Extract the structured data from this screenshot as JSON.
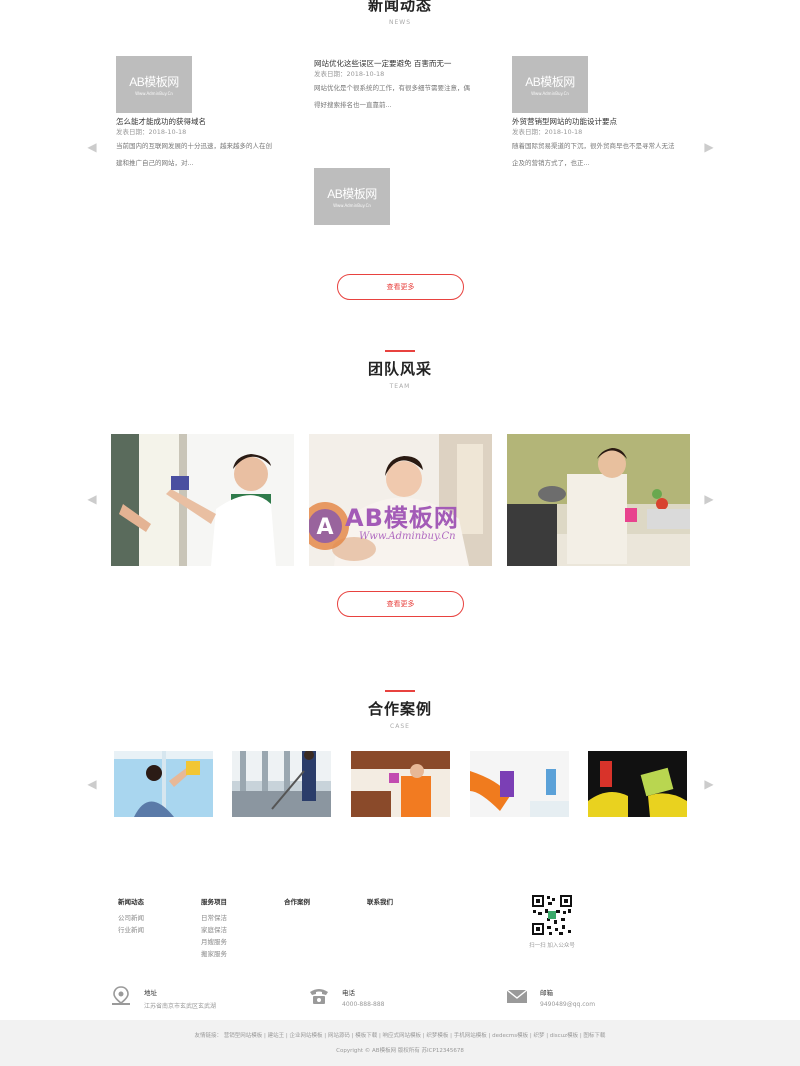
{
  "news": {
    "title": "新闻动态",
    "subtitle": "NEWS",
    "placeholder_logo": "AB模板网",
    "placeholder_sub": "Www.AdminBuy.Cn",
    "date_label": "发表日期：",
    "items": [
      {
        "title": "怎么能才能成功的获得域名",
        "date": "2018-10-18",
        "desc1": "当前国内的互联网发展的十分迅速，越来越多的人在创",
        "desc2": "建和推广自己的网站，对..."
      },
      {
        "title": "网站优化这些误区一定要避免 百害而无一",
        "date": "2018-10-18",
        "desc1": "网站优化是个很系统的工作，有很多细节需要注意，偶",
        "desc2": "得好搜索排名也一直靠前..."
      },
      {
        "title": "外贸营销型网站的功能设计要点",
        "date": "2018-10-18",
        "desc1": "随着国际贸易渠道的下沉，很外贸商早也不是寻常人无法",
        "desc2": "企及的营销方式了，也正..."
      }
    ],
    "more": "查看更多"
  },
  "team": {
    "title": "团队风采",
    "subtitle": "TEAM",
    "watermark": "AB模板网",
    "watermark_url": "Www.Adminbuy.Cn",
    "more": "查看更多"
  },
  "cases": {
    "title": "合作案例",
    "subtitle": "CASE"
  },
  "footer": {
    "cols": [
      {
        "h": "新闻动态",
        "links": [
          "公司新闻",
          "行业新闻"
        ]
      },
      {
        "h": "服务项目",
        "links": [
          "日常保洁",
          "家庭保洁",
          "月嫂服务",
          "搬家服务"
        ]
      },
      {
        "h": "合作案例",
        "links": []
      },
      {
        "h": "联系我们",
        "links": []
      }
    ],
    "qr_caption": "扫一扫 加入公众号",
    "address_label": "地址",
    "address": "江苏省南京市玄武区玄武湖",
    "phone_label": "电话",
    "phone": "4000-888-888",
    "email_label": "邮箱",
    "email": "9490489@qq.com",
    "links": "友情链接： 营销型网站模板 | 建站王 | 企业网站模板 | 网站源码 | 模板下载 | 响应式网站模板 | 织梦模板 | 手机网站模板 | dedecms模板 | 织梦 | discuz模板 | 图标下载",
    "copyright": "Copyright © AB模板网 版权所有 苏ICP12345678"
  },
  "colors": {
    "accent": "#e8423f",
    "placeholder": "#bdbdbd"
  }
}
